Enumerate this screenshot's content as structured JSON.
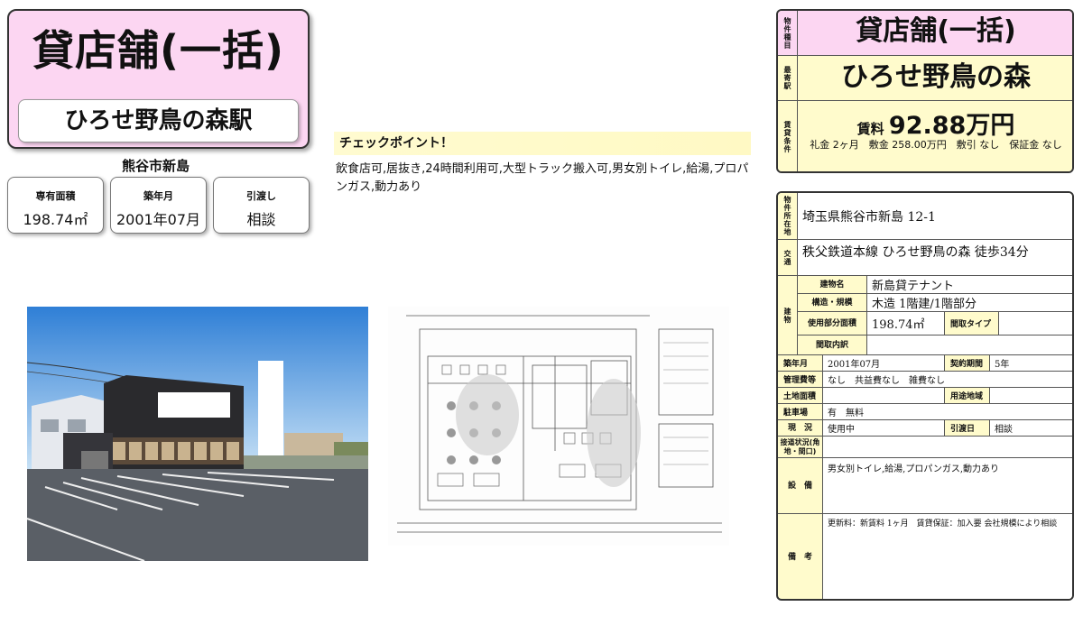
{
  "header": {
    "type": "貸店舗(一括)",
    "station": "ひろせ野鳥の森駅",
    "area": "熊谷市新島"
  },
  "info_boxes": [
    {
      "label": "専有面積",
      "value": "198.74㎡"
    },
    {
      "label": "築年月",
      "value": "2001年07月"
    },
    {
      "label": "引渡し",
      "value": "相談"
    }
  ],
  "checkpoint": {
    "title": "チェックポイント！",
    "text": "飲食店可,居抜き,24時間利用可,大型トラック搬入可,男女別トイレ,給湯,プロパンガス,動力あり"
  },
  "summary": {
    "type_label": "物件種目",
    "type": "貸店舗(一括)",
    "station_label": "最寄駅",
    "station": "ひろせ野鳥の森",
    "rent_label": "賃貸条件",
    "rent_prefix": "賃料",
    "rent_value": "92.88万円",
    "conditions": "礼金 2ヶ月　敷金 258.00万円　敷引 なし　保証金 なし"
  },
  "details": {
    "location_label": "物件所在地",
    "location": "埼玉県熊谷市新島 12-1",
    "access_label": "交通",
    "access": "秩父鉄道本線 ひろせ野鳥の森 徒歩34分",
    "building_label": "建物",
    "building_name_label": "建物名",
    "building_name": "新島貸テナント",
    "structure_label": "構造・規模",
    "structure": "木造 1階建/1階部分",
    "area_label": "使用部分面積",
    "area": "198.74㎡",
    "layout_type_label": "間取タイプ",
    "layout_type": "",
    "layout_detail_label": "間取内訳",
    "layout_detail": "",
    "built_label": "築年月",
    "built": "2001年07月",
    "contract_label": "契約期間",
    "contract": "5年",
    "mgmt_label": "管理費等",
    "mgmt": "なし　共益費なし　雑費なし",
    "land_label": "土地面積",
    "land": "",
    "zoning_label": "用途地域",
    "zoning": "",
    "parking_label": "駐車場",
    "parking": "有　無料",
    "status_label": "現　況",
    "status": "使用中",
    "handover_label": "引渡日",
    "handover": "相談",
    "road_label": "接道状況(角地・間口)",
    "road": "",
    "equipment_label": "設　備",
    "equipment": "男女別トイレ,給湯,プロパンガス,動力あり",
    "remarks_label": "備　考",
    "remarks": "更新料：新賃料 1ヶ月　賃貸保証：加入要 会社規模により相談"
  },
  "colors": {
    "pink": "#fcd6f2",
    "yellow": "#fffbcc",
    "checkpoint": "#fff9c4"
  }
}
